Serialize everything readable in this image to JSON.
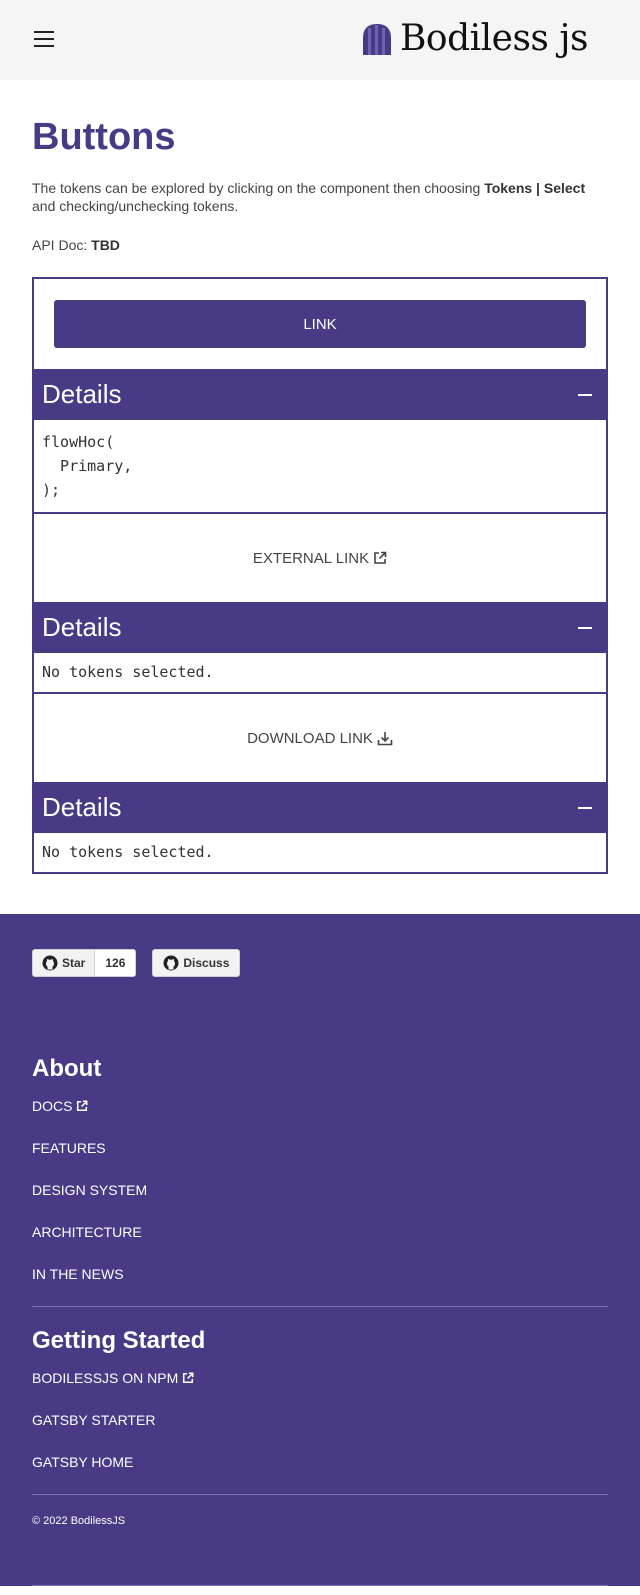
{
  "header": {
    "logo_text": "Bodiless js",
    "logo_icon": "beanie-logo-icon",
    "menu_icon": "hamburger-menu-icon"
  },
  "main": {
    "title": "Buttons",
    "intro_pre": "The tokens can be explored by clicking on  the component then choosing ",
    "intro_bold": "Tokens | Select",
    "intro_post": " and checking/unchecking tokens.",
    "api_label": "API Doc: ",
    "api_value": "TBD"
  },
  "demos": [
    {
      "button_label": "LINK",
      "details_title": "Details",
      "code": "flowHoc(\n  Primary,\n);"
    },
    {
      "button_label": "EXTERNAL LINK",
      "icon": "external-link-icon",
      "details_title": "Details",
      "code": "No tokens selected."
    },
    {
      "button_label": "DOWNLOAD LINK",
      "icon": "download-icon",
      "details_title": "Details",
      "code": "No tokens selected."
    }
  ],
  "footer": {
    "github_star_label": "Star",
    "github_star_count": "126",
    "github_discuss_label": "Discuss",
    "about_heading": "About",
    "about_links": [
      "DOCS",
      "FEATURES",
      "DESIGN SYSTEM",
      "ARCHITECTURE",
      "IN THE NEWS"
    ],
    "getting_started_heading": "Getting Started",
    "getting_started_links": [
      "BODILESSJS ON NPM",
      "GATSBY STARTER",
      "GATSBY HOME"
    ],
    "copyright": "©  2022 BodilessJS"
  },
  "colors": {
    "brand_purple": "#483a85",
    "header_bg": "#f5f5f5"
  }
}
